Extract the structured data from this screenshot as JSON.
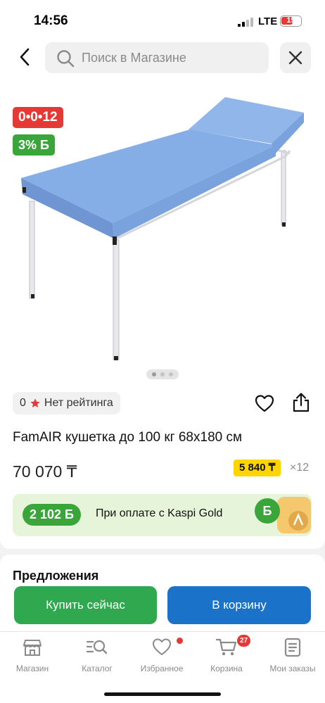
{
  "status_bar": {
    "time": "14:56",
    "network": "LTE",
    "battery": "19"
  },
  "search": {
    "placeholder": "Поиск в Магазине",
    "back_icon": "chevron-left-icon",
    "clear_icon": "close-icon"
  },
  "product": {
    "badges": {
      "installment": "0•0•12",
      "bonus": "3% Б"
    },
    "image_pager": {
      "count": 3,
      "active": 0
    },
    "rating": {
      "value": "0",
      "text": "Нет рейтинга"
    },
    "title": "FamAIR кушетка до 100 кг 68x180 см",
    "price": "70 070 ₸",
    "monthly_payment": "5 840 ₸",
    "monthly_count": "×12"
  },
  "kaspi_gold": {
    "amount": "2 102 Б",
    "text": "При оплате с Kaspi Gold",
    "logo": "Б"
  },
  "offers": {
    "title": "Предложения"
  },
  "actions": {
    "buy_now": "Купить сейчас",
    "add_to_cart": "В корзину"
  },
  "tab_bar": {
    "items": [
      {
        "label": "Магазин",
        "icon": "store-icon"
      },
      {
        "label": "Каталог",
        "icon": "catalog-search-icon"
      },
      {
        "label": "Избранное",
        "icon": "heart-icon",
        "dot": true
      },
      {
        "label": "Корзина",
        "icon": "cart-icon",
        "badge": "27"
      },
      {
        "label": "Мои заказы",
        "icon": "orders-icon"
      }
    ]
  },
  "colors": {
    "green": "#2fa84f",
    "blue": "#1a73c9",
    "red": "#e53935",
    "yellow": "#ffd500",
    "upholstery": "#86aee6"
  }
}
